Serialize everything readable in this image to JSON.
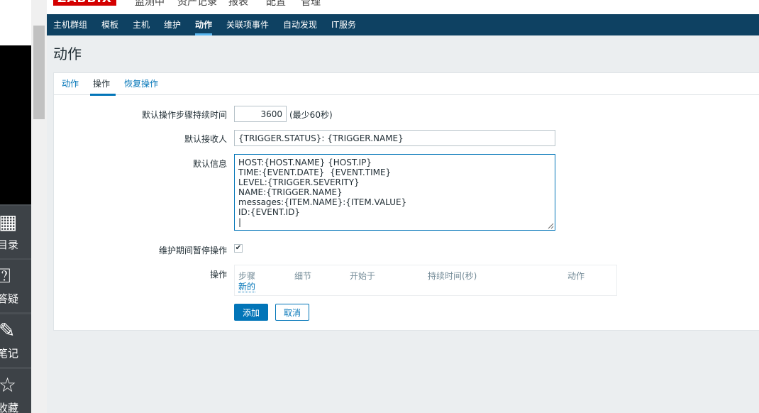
{
  "app": {
    "logo": "ZABBIX"
  },
  "top_menu": [
    "监测中",
    "资产记录",
    "报表",
    "配置",
    "管理"
  ],
  "subnav": {
    "items": [
      "主机群组",
      "模板",
      "主机",
      "维护",
      "动作",
      "关联项事件",
      "自动发现",
      "IT服务"
    ],
    "active": "动作"
  },
  "page": {
    "title": "动作"
  },
  "tabs": {
    "items": [
      "动作",
      "操作",
      "恢复操作"
    ],
    "active": "操作"
  },
  "form": {
    "step_duration_label": "默认操作步骤持续时间",
    "step_duration_value": "3600",
    "step_duration_hint": "(最少60秒)",
    "subject_label": "默认接收人",
    "subject_value": "{TRIGGER.STATUS}: {TRIGGER.NAME}",
    "message_label": "默认信息",
    "message_value": "HOST:{HOST.NAME} {HOST.IP}\nTIME:{EVENT.DATE}  {EVENT.TIME}\nLEVEL:{TRIGGER.SEVERITY}\nNAME:{TRIGGER.NAME}\nmessages:{ITEM.NAME}:{ITEM.VALUE}\nID:{EVENT.ID}\n|",
    "pause_label": "维护期间暂停操作",
    "pause_checked": "✔",
    "operations_label": "操作",
    "operations_columns": [
      "步骤",
      "细节",
      "开始于",
      "持续时间(秒)",
      "动作"
    ],
    "operations_new_link": "新的"
  },
  "buttons": {
    "add": "添加",
    "cancel": "取消"
  },
  "side_rail": {
    "items": [
      {
        "label": "目录",
        "icon": "calendar-icon"
      },
      {
        "label": "答疑",
        "icon": "question-icon"
      },
      {
        "label": "笔记",
        "icon": "edit-icon"
      },
      {
        "label": "收藏",
        "icon": "star-icon"
      }
    ]
  },
  "colors": {
    "nav_bg": "#0e4162",
    "accent": "#0275b8",
    "logo_red": "#d40000"
  }
}
